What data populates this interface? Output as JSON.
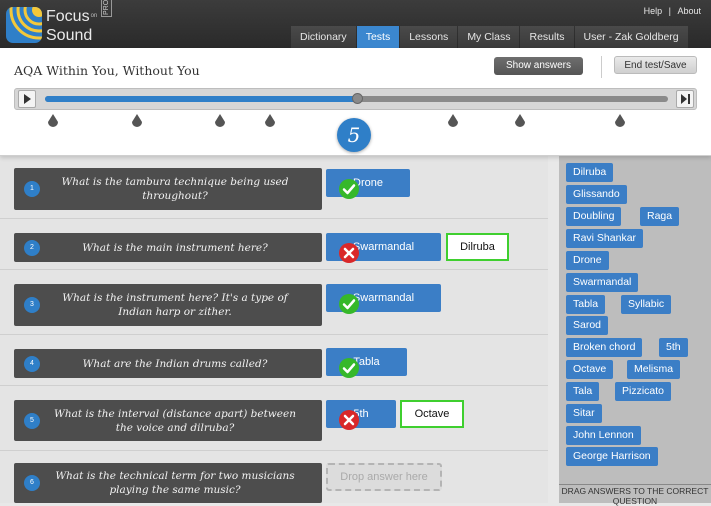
{
  "brand": {
    "name_line1": "Focus",
    "on": "on",
    "name_line2": "Sound",
    "pro": "PRO"
  },
  "util_links": {
    "help": "Help",
    "sep": "|",
    "about": "About"
  },
  "nav": {
    "tabs": [
      "Dictionary",
      "Tests",
      "Lessons",
      "My Class",
      "Results",
      "User - Zak Goldberg"
    ],
    "active": "Tests"
  },
  "test": {
    "title": "AQA Within You, Without You",
    "show_answers": "Show answers",
    "end_test": "End test/Save",
    "current_question": "5",
    "progress_percent": 50,
    "play_icon": "play-icon",
    "end_icon": "skip-to-end-icon"
  },
  "questions": [
    {
      "num": "1",
      "text": "What is the tambura technique being used throughout?",
      "answer": "Drone",
      "result": "correct"
    },
    {
      "num": "2",
      "text": "What is the main instrument here?",
      "answer": "Swarmandal",
      "result": "wrong",
      "correct_answer": "Dilruba"
    },
    {
      "num": "3",
      "text": "What is the instrument here? It's a type of Indian harp or zither.",
      "answer": "Swarmandal",
      "result": "correct"
    },
    {
      "num": "4",
      "text": "What are the Indian drums called?",
      "answer": "Tabla",
      "result": "correct"
    },
    {
      "num": "5",
      "text": "What is the interval (distance apart) between the voice and dilruba?",
      "answer": "5th",
      "result": "wrong",
      "correct_answer": "Octave"
    },
    {
      "num": "6",
      "text": "What is the technical term for two musicians playing the same music?",
      "placeholder": "Drop answer here"
    }
  ],
  "answer_bank": {
    "chips": [
      "Dilruba",
      "Glissando",
      "Doubling",
      "Raga",
      "Ravi Shankar",
      "Drone",
      "Swarmandal",
      "Tabla",
      "Syllabic",
      "Sarod",
      "Broken chord",
      "5th",
      "Octave",
      "Melisma",
      "Tala",
      "Pizzicato",
      "Sitar",
      "John Lennon",
      "George Harrison"
    ],
    "footer": "DRAG ANSWERS TO THE CORRECT QUESTION"
  },
  "colors": {
    "accent": "#3b7ec6",
    "correct": "#36b82a",
    "wrong": "#d9282a",
    "header": "#333333"
  }
}
